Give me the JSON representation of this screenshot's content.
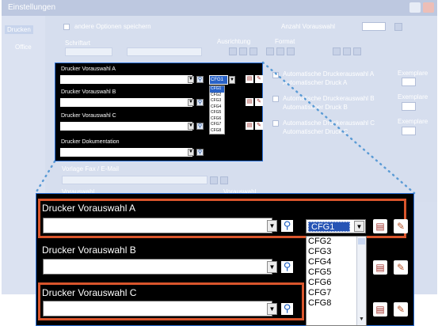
{
  "window": {
    "title": "Einstellungen",
    "sidebar": [
      {
        "label": "Drucken"
      },
      {
        "label": "Office"
      }
    ]
  },
  "background": {
    "checkbox_label": "andere Optionen speichern",
    "count_label": "Anzahl Vorauswahl",
    "schriftart_label": "Schriftart",
    "ausrichtung_label": "Ausrichtung",
    "format_label": "Format",
    "auto_a": "Automatische Druckerauswahl A",
    "auto_a2": "Automatischer Druck A",
    "auto_b": "Automatische Druckerauswahl B",
    "auto_b2": "Automatischer Druck B",
    "auto_c": "Automatische Druckerauswahl C",
    "auto_c2": "Automatischer Druck C",
    "exemplare": "Exemplare",
    "vorlage": "Vorlage Fax / E-Mail",
    "extra_left": "Vorauswahl",
    "extra_right": "Vorauswahl"
  },
  "small_panel": {
    "labels": [
      "Drucker Vorauswahl A",
      "Drucker Vorauswahl B",
      "Drucker Vorauswahl C",
      "Drucker Dokumentation"
    ],
    "selected": "CFG1",
    "options": [
      "CFG1",
      "CFG2",
      "CFG3",
      "CFG4",
      "CFG5",
      "CFG6",
      "CFG7",
      "CFG8"
    ]
  },
  "big_panel": {
    "label_a": "Drucker Vorauswahl A",
    "label_b": "Drucker Vorauswahl B",
    "label_c": "Drucker Vorauswahl C",
    "cfg_selected": "CFG1",
    "cfg_options": [
      "CFG2",
      "CFG3",
      "CFG4",
      "CFG5",
      "CFG6",
      "CFG7",
      "CFG8"
    ]
  },
  "icons": {
    "dropdown": "dropdown-arrow-icon",
    "search": "magnifier-icon",
    "printer_edit": "printer-edit-icon",
    "tools": "brush-tools-icon"
  },
  "colors": {
    "highlight": "#d9552c",
    "selection": "#2654b5",
    "dots": "#5b9bd5"
  }
}
